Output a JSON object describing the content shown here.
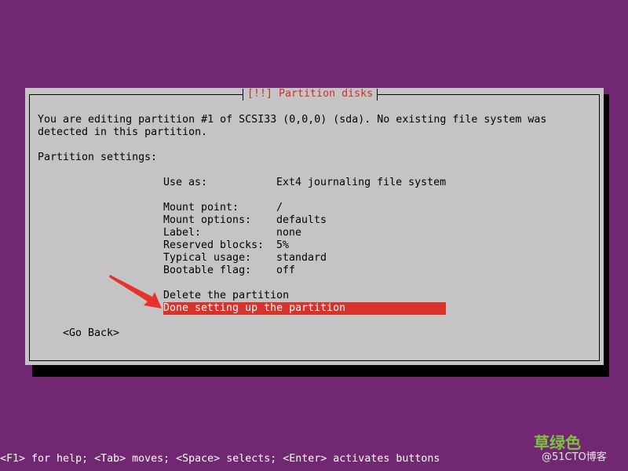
{
  "dialog": {
    "title": "[!!] Partition disks",
    "intro_line_1": "You are editing partition #1 of SCSI33 (0,0,0) (sda). No existing file system was",
    "intro_line_2": "detected in this partition.",
    "settings_heading": "Partition settings:",
    "settings": [
      {
        "label": "Use as:",
        "value": "Ext4 journaling file system"
      },
      {
        "label": "Mount point:",
        "value": "/"
      },
      {
        "label": "Mount options:",
        "value": "defaults"
      },
      {
        "label": "Label:",
        "value": "none"
      },
      {
        "label": "Reserved blocks:",
        "value": "5%"
      },
      {
        "label": "Typical usage:",
        "value": "standard"
      },
      {
        "label": "Bootable flag:",
        "value": "off"
      }
    ],
    "actions": [
      {
        "label": "Delete the partition"
      },
      {
        "label": "Done setting up the partition",
        "selected": true
      }
    ],
    "go_back_label": "<Go Back>"
  },
  "help_line": "<F1> for help; <Tab> moves; <Space> selects; <Enter> activates buttons",
  "watermark": {
    "logo_text": "草绿色",
    "site_text": "@51CTO博客"
  },
  "colors": {
    "background": "#722773",
    "dialog": "#c4c4c4",
    "title_text": "#d03023",
    "selection": "#d9322a",
    "arrow": "#e8332b"
  }
}
